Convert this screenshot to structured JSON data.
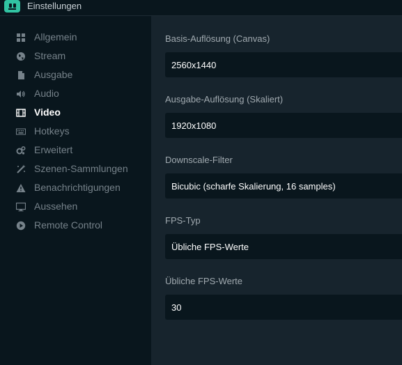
{
  "window": {
    "title": "Einstellungen"
  },
  "sidebar": {
    "items": [
      {
        "label": "Allgemein",
        "icon": "grid-icon",
        "active": false
      },
      {
        "label": "Stream",
        "icon": "globe-icon",
        "active": false
      },
      {
        "label": "Ausgabe",
        "icon": "document-icon",
        "active": false
      },
      {
        "label": "Audio",
        "icon": "speaker-icon",
        "active": false
      },
      {
        "label": "Video",
        "icon": "film-icon",
        "active": true
      },
      {
        "label": "Hotkeys",
        "icon": "keyboard-icon",
        "active": false
      },
      {
        "label": "Erweitert",
        "icon": "gears-icon",
        "active": false
      },
      {
        "label": "Szenen-Sammlungen",
        "icon": "magic-wand-icon",
        "active": false
      },
      {
        "label": "Benachrichtigungen",
        "icon": "warning-icon",
        "active": false
      },
      {
        "label": "Aussehen",
        "icon": "monitor-icon",
        "active": false
      },
      {
        "label": "Remote Control",
        "icon": "play-circle-icon",
        "active": false
      }
    ]
  },
  "video": {
    "fields": [
      {
        "label": "Basis-Auflösung (Canvas)",
        "value": "2560x1440"
      },
      {
        "label": "Ausgabe-Auflösung (Skaliert)",
        "value": "1920x1080"
      },
      {
        "label": "Downscale-Filter",
        "value": "Bicubic (scharfe Skalierung, 16 samples)"
      },
      {
        "label": "FPS-Typ",
        "value": "Übliche FPS-Werte"
      },
      {
        "label": "Übliche FPS-Werte",
        "value": "30"
      }
    ]
  },
  "colors": {
    "sidebar_bg": "#09161d",
    "content_bg": "#17242d",
    "accent": "#31c3a2",
    "inactive_text": "#76828a",
    "active_text": "#ffffff"
  }
}
